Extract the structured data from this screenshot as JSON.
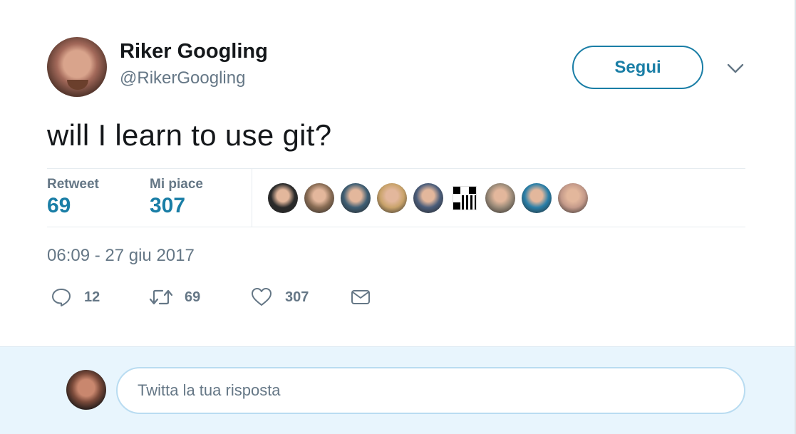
{
  "author": {
    "display_name": "Riker Googling",
    "handle": "@RikerGoogling"
  },
  "follow_button_label": "Segui",
  "tweet_text": "will I learn to use git?",
  "stats": {
    "retweet_label": "Retweet",
    "retweet_count": "69",
    "likes_label": "Mi piace",
    "likes_count": "307"
  },
  "likers_faces": [
    {
      "icon": "avatar-face",
      "color": "#2b2b2b"
    },
    {
      "icon": "avatar-face",
      "color": "#8a6d55"
    },
    {
      "icon": "avatar-face",
      "color": "#3f5e73"
    },
    {
      "icon": "avatar-face",
      "color": "#c9a36b"
    },
    {
      "icon": "avatar-face",
      "color": "#4b5d7a"
    },
    {
      "icon": "qr-code-avatar",
      "color": "#000000"
    },
    {
      "icon": "avatar-face",
      "color": "#9a8a78"
    },
    {
      "icon": "avatar-face",
      "color": "#2a7fa8"
    },
    {
      "icon": "avatar-face",
      "color": "#c49a8a"
    }
  ],
  "timestamp": "06:09 - 27 giu 2017",
  "actions": {
    "reply_count": "12",
    "retweet_count": "69",
    "like_count": "307"
  },
  "reply_box": {
    "placeholder": "Twitta la tua risposta"
  },
  "colors": {
    "accent": "#1a7ea6",
    "muted_text": "#657786",
    "reply_background": "#e8f5fd",
    "divider": "#e6ecf0"
  }
}
